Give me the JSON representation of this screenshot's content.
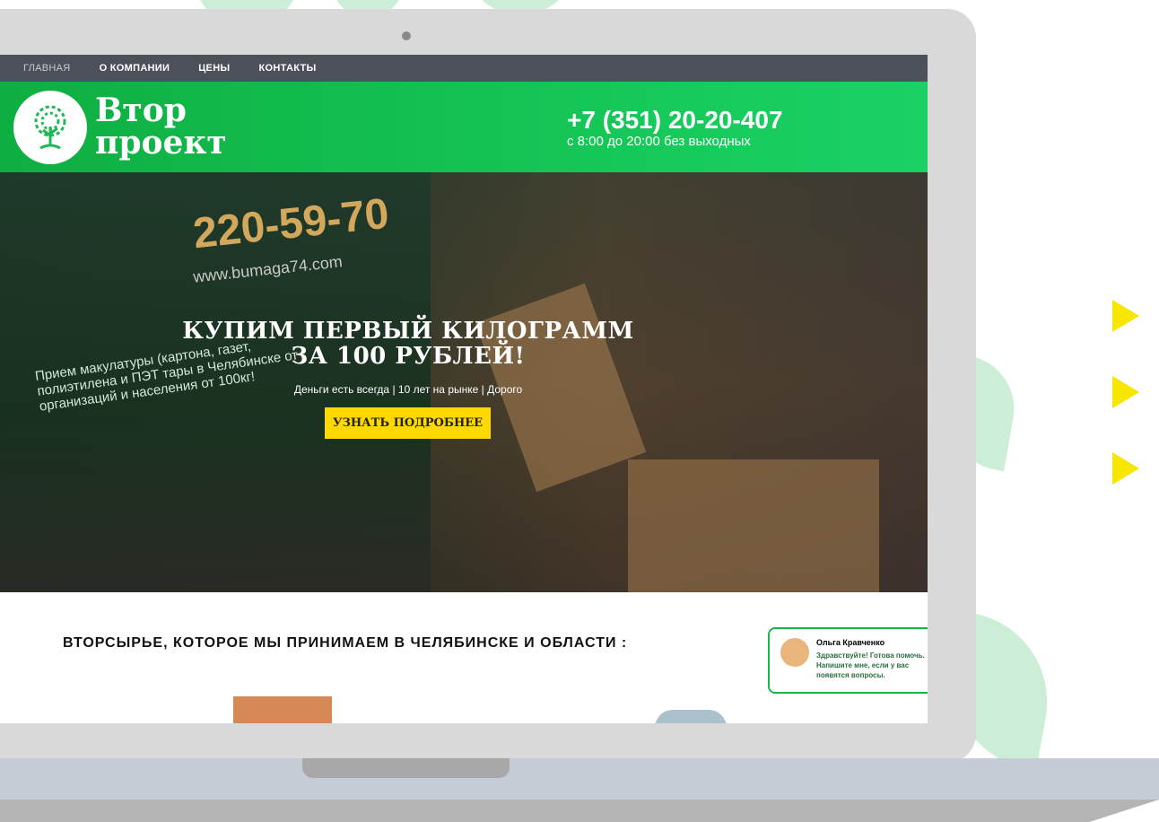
{
  "nav": {
    "items": [
      "ГЛАВНАЯ",
      "О КОМПАНИИ",
      "ЦЕНЫ",
      "КОНТАКТЫ"
    ]
  },
  "header": {
    "brand_line1": "Втор",
    "brand_line2": "проект",
    "phone": "+7 (351) 20-20-407",
    "hours": "с 8:00 до 20:00 без выходных"
  },
  "hero": {
    "title_line1": "КУПИМ ПЕРВЫЙ КИЛОГРАММ",
    "title_line2": "ЗА 100 РУБЛЕЙ!",
    "subtitle": "Деньги есть всегда | 10 лет на рынке | Дорого",
    "button": "УЗНАТЬ ПОДРОБНЕЕ",
    "truck_phone": "220-59-70",
    "truck_site": "www.bumaga74.com",
    "truck_text": "Прием макулатуры (картона, газет, полиэтилена и ПЭТ тары в Челябинске от организаций и населения от 100кг!"
  },
  "section": {
    "title": "ВТОРСЫРЬЕ, КОТОРОЕ МЫ ПРИНИМАЕМ В ЧЕЛЯБИНСКЕ И ОБЛАСТИ :"
  },
  "chat": {
    "name": "Ольга Кравченко",
    "message": "Здравствуйте! Готова помочь. Напишите мне, если у вас появятся вопросы."
  },
  "colors": {
    "green": "#16c95a",
    "nav": "#4c5058",
    "button": "#ffd800",
    "arrow": "#f6e600"
  }
}
